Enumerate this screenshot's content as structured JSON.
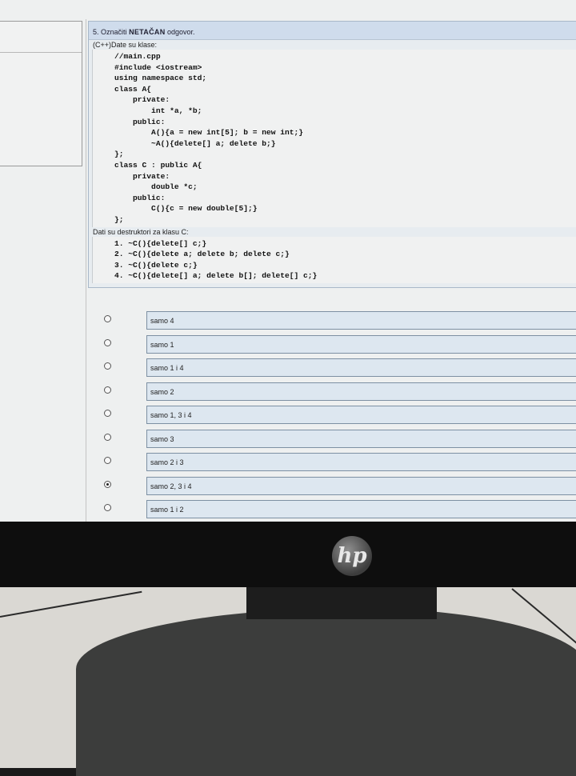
{
  "question": {
    "number": "5.",
    "title_pre": "Označiti",
    "title_bold": "NETAČAN",
    "title_post": "odgovor.",
    "intro": "(C++)Date su klase:",
    "code": [
      "//main.cpp",
      "#include <iostream>",
      "using namespace std;",
      "class A{",
      "    private:",
      "        int *a, *b;",
      "    public:",
      "        A(){a = new int[5]; b = new int;}",
      "        ~A(){delete[] a; delete b;}",
      "};",
      "class C : public A{",
      "    private:",
      "        double *c;",
      "    public:",
      "        C(){c = new double[5];}",
      "};"
    ],
    "destructors_label": "Dati su destruktori za klasu C:",
    "destructors": [
      "1. ~C(){delete[] c;}",
      "2. ~C(){delete a; delete b; delete c;}",
      "3. ~C(){delete c;}",
      "4. ~C(){delete[] a; delete b[]; delete[] c;}"
    ]
  },
  "answers": [
    {
      "label": "samo 4",
      "checked": false
    },
    {
      "label": "samo 1",
      "checked": false
    },
    {
      "label": "samo 1 i 4",
      "checked": false
    },
    {
      "label": "samo 2",
      "checked": false
    },
    {
      "label": "samo 1, 3 i 4",
      "checked": false
    },
    {
      "label": "samo 3",
      "checked": false
    },
    {
      "label": "samo 2 i 3",
      "checked": false
    },
    {
      "label": "samo 2, 3 i 4",
      "checked": true
    },
    {
      "label": "samo 1 i 2",
      "checked": false
    }
  ],
  "monitor": {
    "brand_logo": "hp",
    "logo_icon": "hp-logo-icon"
  },
  "colors": {
    "title_bar": "#cfdcec",
    "answer_bg": "#dde7f0",
    "answer_border": "#7d90a3"
  }
}
